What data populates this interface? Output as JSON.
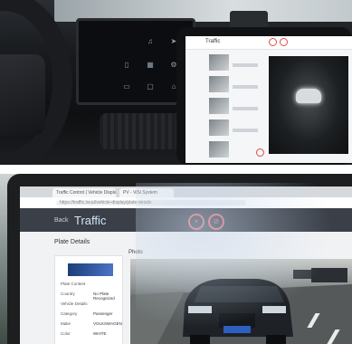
{
  "top_photo": {
    "tablet_app_title": "Traffic"
  },
  "bottom_photo": {
    "browser_tabs": [
      "Traffic Control | Vehicle Display",
      "PV - ViSi System"
    ],
    "url": "https://traffic.local/vehicle-display/plate-details",
    "app_title": "Traffic",
    "back_label": "Back",
    "section_title": "Plate Details",
    "photo_label": "Photo",
    "plate_details": [
      {
        "label": "Plate Content",
        "value": ""
      },
      {
        "label": "Country",
        "value": "No Plate Recognized"
      },
      {
        "label": "Vehicle Details",
        "value": ""
      },
      {
        "label": "Category",
        "value": "Passenger"
      },
      {
        "label": "Make",
        "value": "VOLKSWAGEN"
      },
      {
        "label": "Color",
        "value": "WHITE"
      }
    ],
    "status_icons": [
      "close-circle-icon",
      "no-entry-icon"
    ],
    "accent_color": "#e36a6a",
    "header_color": "#3a3f48"
  }
}
